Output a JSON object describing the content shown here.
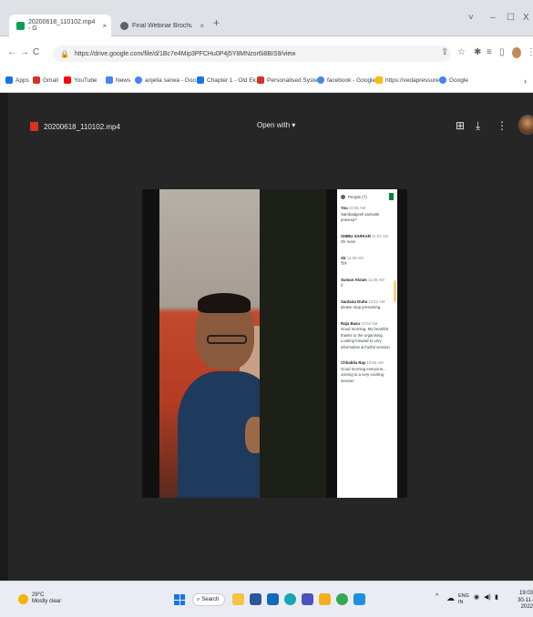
{
  "browser": {
    "tabs": [
      {
        "title": "20200618_110102.mp4 - G",
        "active": true
      },
      {
        "title": "Final Webinar Brochure conver",
        "active": false
      }
    ],
    "new_tab": "+",
    "window_controls": {
      "minimize": "–",
      "maximize": "☐",
      "close": "X",
      "dropdown": "˅"
    },
    "nav": {
      "back": "←",
      "forward": "→",
      "reload": "C"
    },
    "address": "https://drive.google.com/file/d/1Bc7e4Mip3PFCHu0P4j5Y8MNzor6i8BIS9/view",
    "bookmarks": [
      {
        "label": "Apps",
        "color": "#1a73e8"
      },
      {
        "label": "Gmail",
        "color": "#d93025"
      },
      {
        "label": "YouTube",
        "color": "#ff0000"
      },
      {
        "label": "News",
        "color": "#4285f4"
      },
      {
        "label": "anjelia sarwa - Goo...",
        "color": "#4285f4"
      },
      {
        "label": "Chapter 1 - Old Ek...",
        "color": "#1a73e8"
      },
      {
        "label": "Personalised Syste...",
        "color": "#d93025"
      },
      {
        "label": "facebook - Google...",
        "color": "#4285f4"
      },
      {
        "label": "https://vedapressure...",
        "color": "#fbbc04"
      },
      {
        "label": "Google",
        "color": "#4285f4"
      }
    ],
    "bookmarks_more": "›"
  },
  "viewer": {
    "file_name": "20200618_110102.mp4",
    "open_with": "Open with ▾",
    "icons": [
      "add-to-drive-icon",
      "download-icon",
      "more-vert-icon"
    ]
  },
  "chat": {
    "header": "People (7)",
    "messages": [
      {
        "who": "You",
        "time": "10:55 AM",
        "text": "Sambadgeeli samvale pravesa?"
      },
      {
        "who": "SHIBU SARKAR",
        "time": "11:02 AM",
        "text": "Ok mam"
      },
      {
        "who": "Sir",
        "time": "11:05 AM",
        "text": "ঠিক"
      },
      {
        "who": "Suman Akram",
        "time": "11:08 AM",
        "text": "ঠ"
      },
      {
        "who": "Santanu Dutta",
        "time": "10:51 AM",
        "text": "please stop presenting"
      },
      {
        "who": "Raju Basu",
        "time": "10:52 AM",
        "text": "Good morning. My heartfelt thanks to the organising. Looking forward to very informative & fruitful session"
      },
      {
        "who": "Chhabila Ray",
        "time": "10:55 AM",
        "text": "Good morning everyone... Joining to a very exciting session"
      }
    ]
  },
  "taskbar": {
    "weather_temp": "29°C",
    "weather_desc": "Mostly clear",
    "search_label": "Search",
    "apps": [
      {
        "name": "file-explorer-icon",
        "color": "#f5c242"
      },
      {
        "name": "terminal-icon",
        "color": "#2b579a"
      },
      {
        "name": "store-icon",
        "color": "#0f6cbd"
      },
      {
        "name": "edge-icon",
        "color": "#1aa5b4"
      },
      {
        "name": "teams-icon",
        "color": "#4b53bc"
      },
      {
        "name": "files-icon",
        "color": "#f2b01e"
      },
      {
        "name": "chrome-icon",
        "color": "#34a853"
      },
      {
        "name": "photos-icon",
        "color": "#1f8fe0"
      }
    ],
    "tray_chevron": "^",
    "language_top": "ENG",
    "language_bottom": "IN",
    "clock_time": "19:03",
    "clock_date": "30-11-2022"
  },
  "colors": {
    "viewer_bg": "#262626",
    "taskbar_bg": "#e9edf3",
    "accent": "#1a73e8"
  }
}
